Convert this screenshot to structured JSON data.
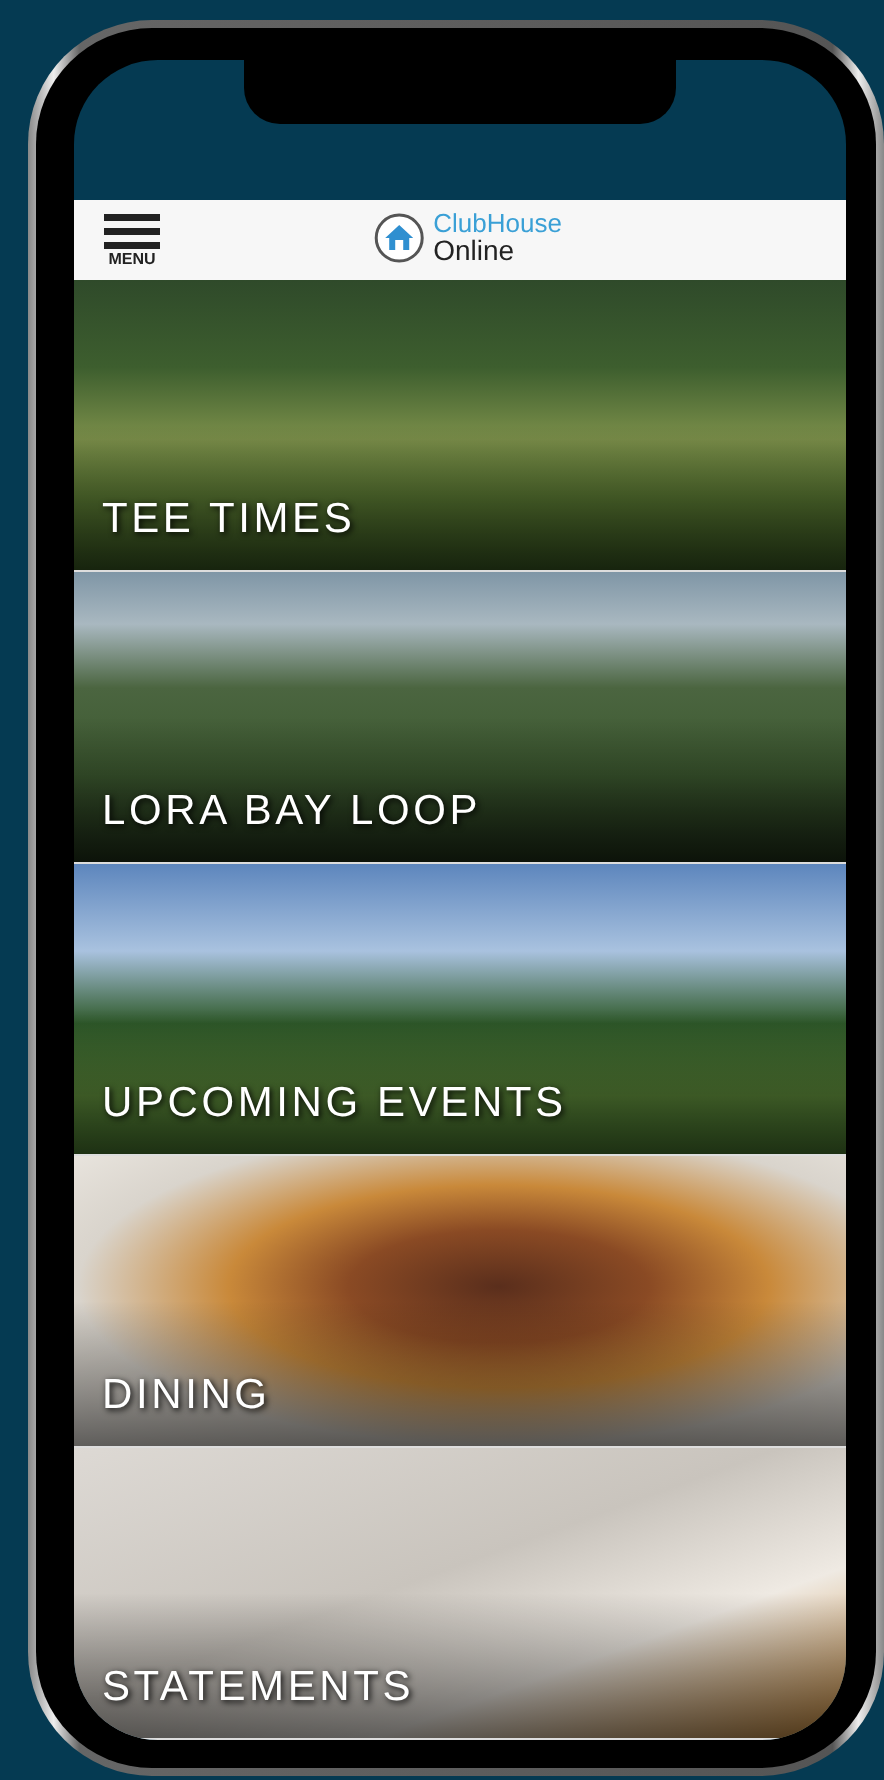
{
  "header": {
    "menu_label": "MENU",
    "logo": {
      "line1": "ClubHouse",
      "line2": "Online"
    }
  },
  "tiles": [
    {
      "title": "TEE TIMES"
    },
    {
      "title": "LORA BAY LOOP"
    },
    {
      "title": "UPCOMING EVENTS"
    },
    {
      "title": "DINING"
    },
    {
      "title": "STATEMENTS"
    }
  ]
}
